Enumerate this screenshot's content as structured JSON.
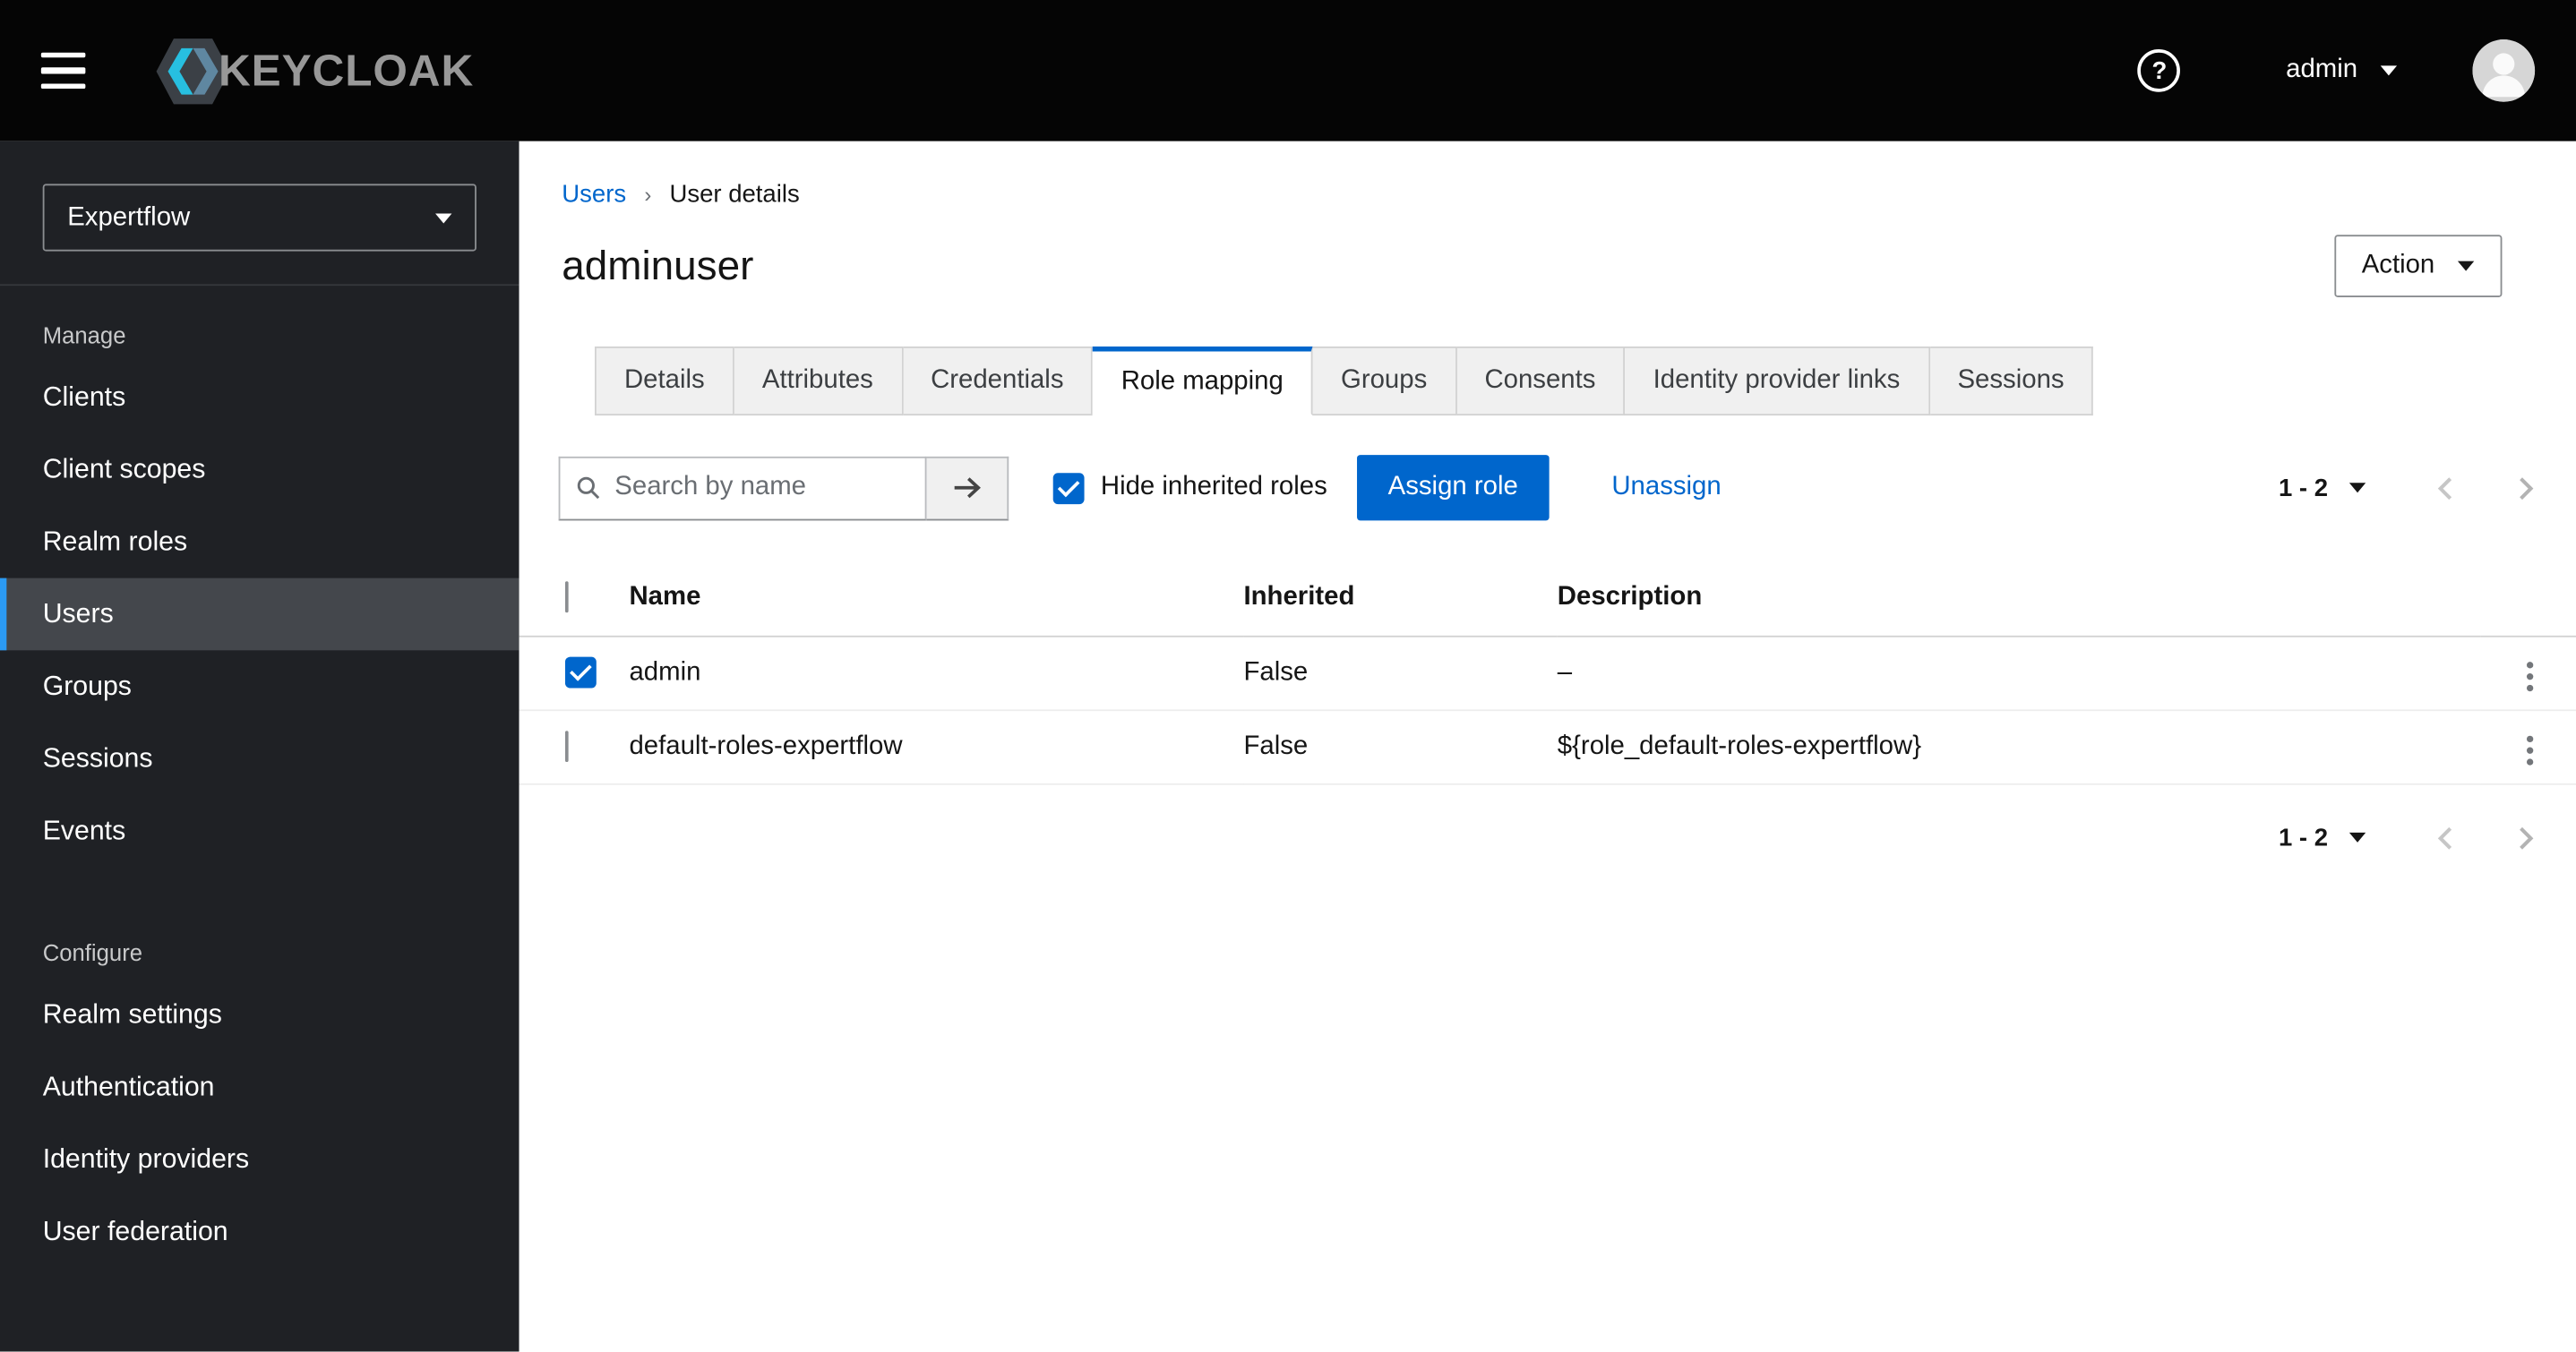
{
  "masthead": {
    "brand": "KEYCLOAK",
    "help_icon_glyph": "?",
    "user": {
      "name": "admin"
    }
  },
  "sidebar": {
    "realm_selector": {
      "value": "Expertflow"
    },
    "sections": [
      {
        "label": "Manage",
        "items": [
          {
            "label": "Clients"
          },
          {
            "label": "Client scopes"
          },
          {
            "label": "Realm roles"
          },
          {
            "label": "Users",
            "active": true
          },
          {
            "label": "Groups"
          },
          {
            "label": "Sessions"
          },
          {
            "label": "Events"
          }
        ]
      },
      {
        "label": "Configure",
        "items": [
          {
            "label": "Realm settings"
          },
          {
            "label": "Authentication"
          },
          {
            "label": "Identity providers"
          },
          {
            "label": "User federation"
          }
        ]
      }
    ]
  },
  "breadcrumb": {
    "items": [
      {
        "label": "Users"
      },
      {
        "label": "User details"
      }
    ]
  },
  "page": {
    "title": "adminuser",
    "action_button": "Action"
  },
  "tabs": [
    {
      "label": "Details"
    },
    {
      "label": "Attributes"
    },
    {
      "label": "Credentials"
    },
    {
      "label": "Role mapping",
      "active": true
    },
    {
      "label": "Groups"
    },
    {
      "label": "Consents"
    },
    {
      "label": "Identity provider links"
    },
    {
      "label": "Sessions"
    }
  ],
  "toolbar": {
    "search_placeholder": "Search by name",
    "hide_inherited_label": "Hide inherited roles",
    "hide_inherited_checked": true,
    "assign_button": "Assign role",
    "unassign_link": "Unassign",
    "pagination": {
      "range": "1 - 2"
    }
  },
  "table": {
    "header_checkbox_checked": false,
    "headers": [
      "Name",
      "Inherited",
      "Description"
    ],
    "rows": [
      {
        "checked": true,
        "name": "admin",
        "inherited": "False",
        "description": "–"
      },
      {
        "checked": false,
        "name": "default-roles-expertflow",
        "inherited": "False",
        "description": "${role_default-roles-expertflow}"
      }
    ]
  },
  "footer_pagination": {
    "range": "1 - 2"
  },
  "colors": {
    "primary": "#0066cc",
    "link": "#0066cc",
    "nav_active_accent": "#2b9af3",
    "masthead_bg": "#050505",
    "sidebar_bg": "#1f2125"
  }
}
